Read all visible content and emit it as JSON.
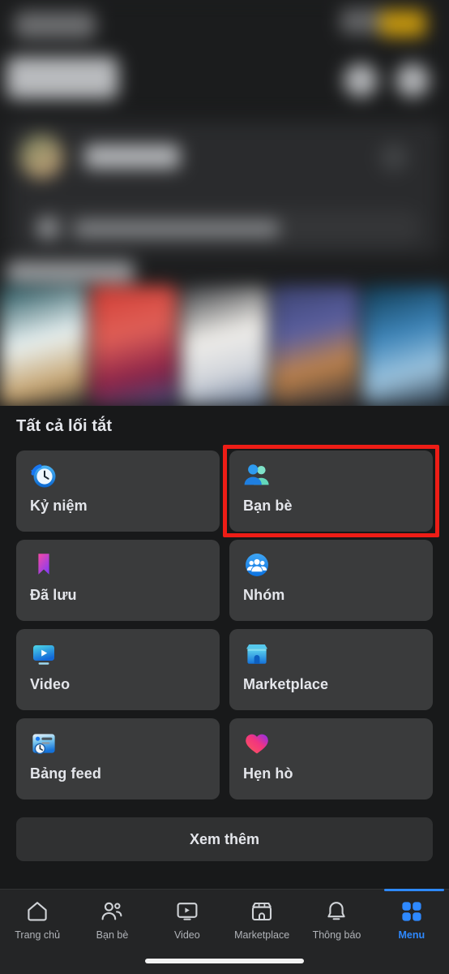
{
  "app": {
    "theme": "dark",
    "background": "#18191a",
    "card_background": "#3a3b3c",
    "accent": "#2e89ff",
    "highlight_color": "#ee1d16"
  },
  "blurred_header": {
    "description": "blurred-profile-and-stories-area",
    "visible_text": ""
  },
  "shortcuts": {
    "section_title": "Tất cả lối tắt",
    "see_more_label": "Xem thêm",
    "items": [
      {
        "label": "Kỷ niệm",
        "icon": "memories-clock-icon",
        "selected": false
      },
      {
        "label": "Bạn bè",
        "icon": "friends-people-icon",
        "selected": true
      },
      {
        "label": "Đã lưu",
        "icon": "saved-bookmark-icon",
        "selected": false
      },
      {
        "label": "Nhóm",
        "icon": "groups-circle-icon",
        "selected": false
      },
      {
        "label": "Video",
        "icon": "video-play-icon",
        "selected": false
      },
      {
        "label": "Marketplace",
        "icon": "marketplace-shop-icon",
        "selected": false
      },
      {
        "label": "Bảng feed",
        "icon": "feeds-card-clock-icon",
        "selected": false
      },
      {
        "label": "Hẹn hò",
        "icon": "dating-heart-icon",
        "selected": false
      }
    ]
  },
  "bottom_nav": {
    "active": "Menu",
    "items": [
      {
        "label": "Trang chủ",
        "icon": "home-icon",
        "active": false
      },
      {
        "label": "Bạn bè",
        "icon": "friends-icon",
        "active": false
      },
      {
        "label": "Video",
        "icon": "video-icon",
        "active": false
      },
      {
        "label": "Marketplace",
        "icon": "marketplace-icon",
        "active": false
      },
      {
        "label": "Thông báo",
        "icon": "bell-icon",
        "active": false
      },
      {
        "label": "Menu",
        "icon": "menu-grid-icon",
        "active": true
      }
    ]
  }
}
